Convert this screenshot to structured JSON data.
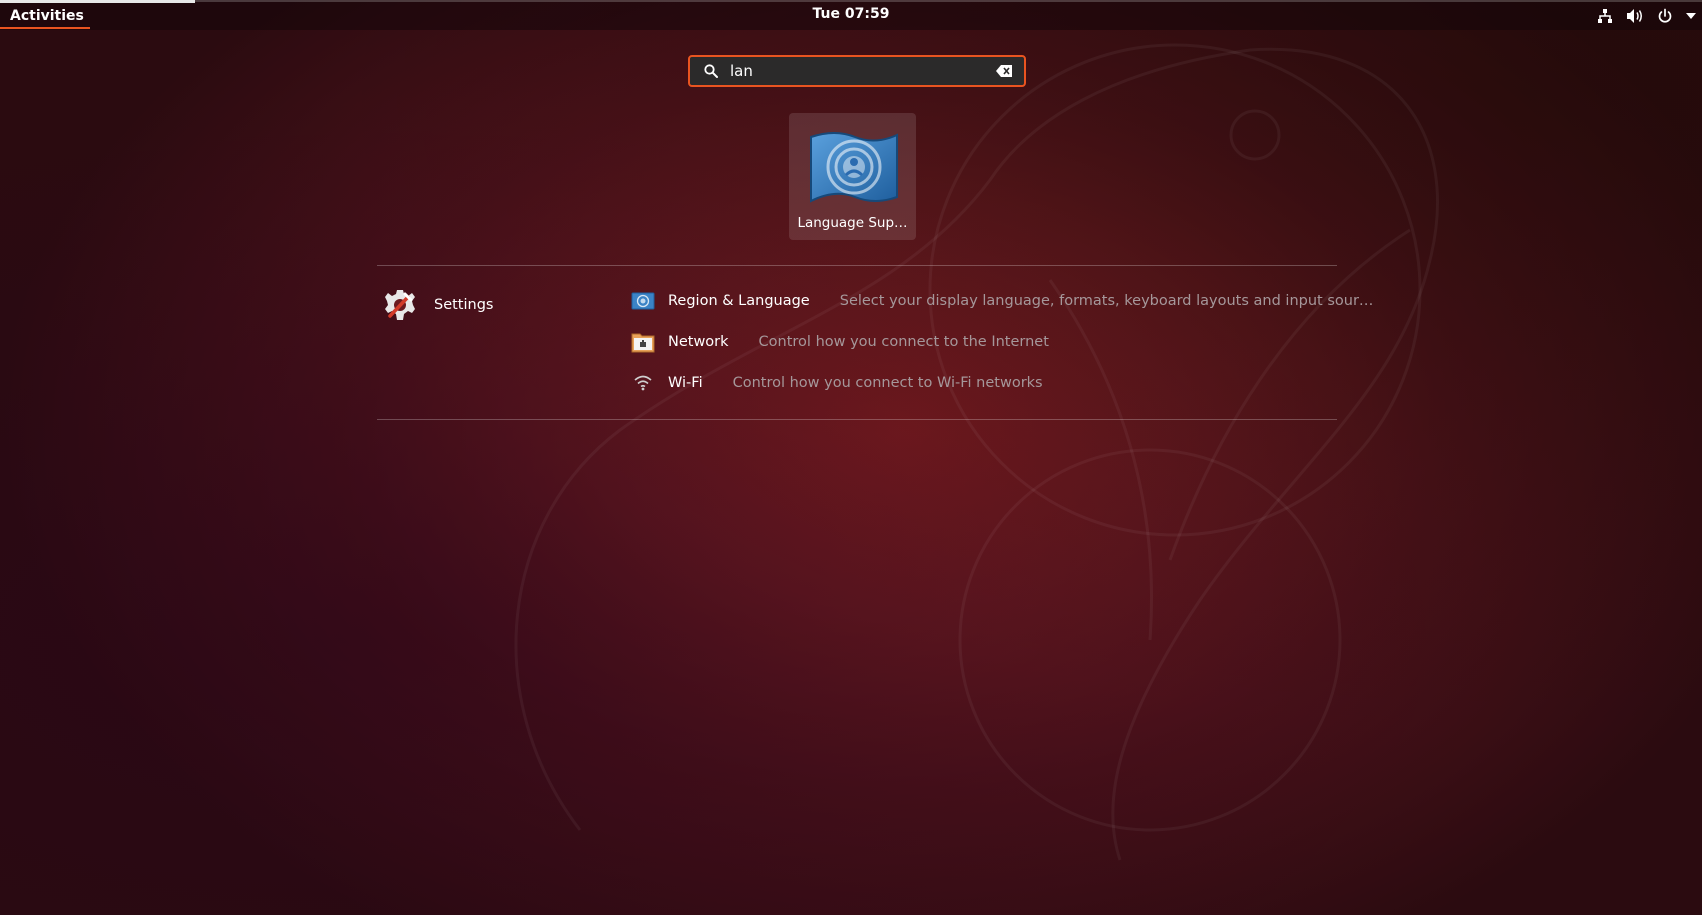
{
  "topbar": {
    "activities_label": "Activities",
    "clock": "Tue 07:59",
    "tray_icons": [
      "network-wired-icon",
      "volume-icon",
      "power-icon",
      "menu-arrow-icon"
    ]
  },
  "search": {
    "value": "lan",
    "icon": "search-icon",
    "clear_icon": "clear-text-icon",
    "accent_color": "#e95420"
  },
  "apps": [
    {
      "label": "Language Sup…",
      "icon": "language-support-flag-icon"
    }
  ],
  "provider": {
    "label": "Settings",
    "icon": "settings-icon"
  },
  "results": [
    {
      "title": "Region & Language",
      "icon": "region-language-icon",
      "description": "Select your display language, formats, keyboard layouts and input sour…"
    },
    {
      "title": "Network",
      "icon": "network-icon",
      "description": "Control how you connect to the Internet"
    },
    {
      "title": "Wi-Fi",
      "icon": "wifi-icon",
      "description": "Control how you connect to Wi-Fi networks"
    }
  ]
}
